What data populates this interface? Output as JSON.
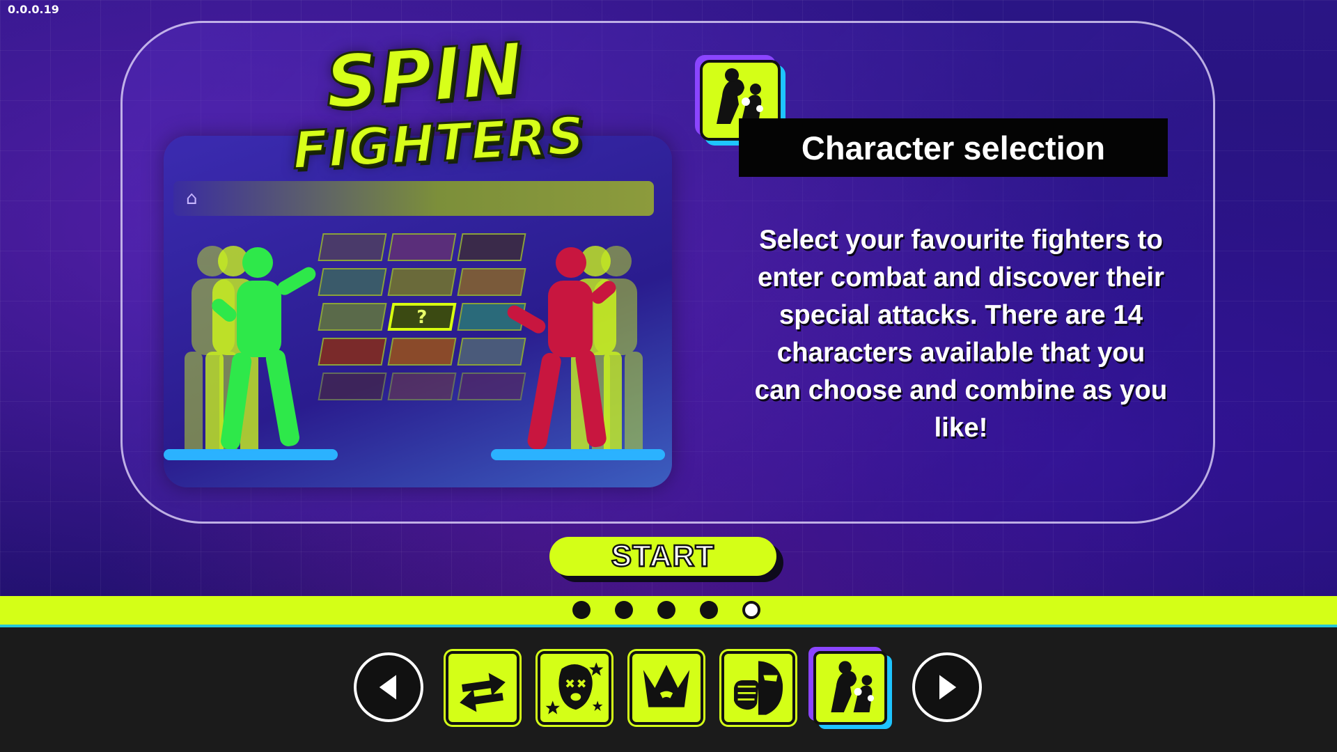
{
  "version": "0.0.0.19",
  "logo": {
    "line1": "SPIN",
    "line2": "FIGHTERS"
  },
  "info": {
    "title": "Character selection",
    "description": "Select your favourite fighters to enter combat and discover their special attacks. There are 14 characters available that you can choose and combine as you like!"
  },
  "preview": {
    "selected_slot_mark": "?"
  },
  "start_label": "START",
  "pagination": {
    "pages": 5,
    "active_page": 5
  },
  "nav": {
    "icons": [
      "arrow-left-icon",
      "swap-arrows-icon",
      "knocked-out-face-icon",
      "crown-icon",
      "punch-face-icon",
      "fighter-silhouettes-icon",
      "arrow-right-icon"
    ],
    "active_tab": "fighter-silhouettes-icon"
  },
  "colors": {
    "accent": "#d4ff17",
    "purple": "#8b45ff",
    "cyan": "#1ec4ff",
    "dark": "#1b1b1b",
    "fighter_green": "#2ee84a",
    "fighter_red": "#c8163f"
  }
}
